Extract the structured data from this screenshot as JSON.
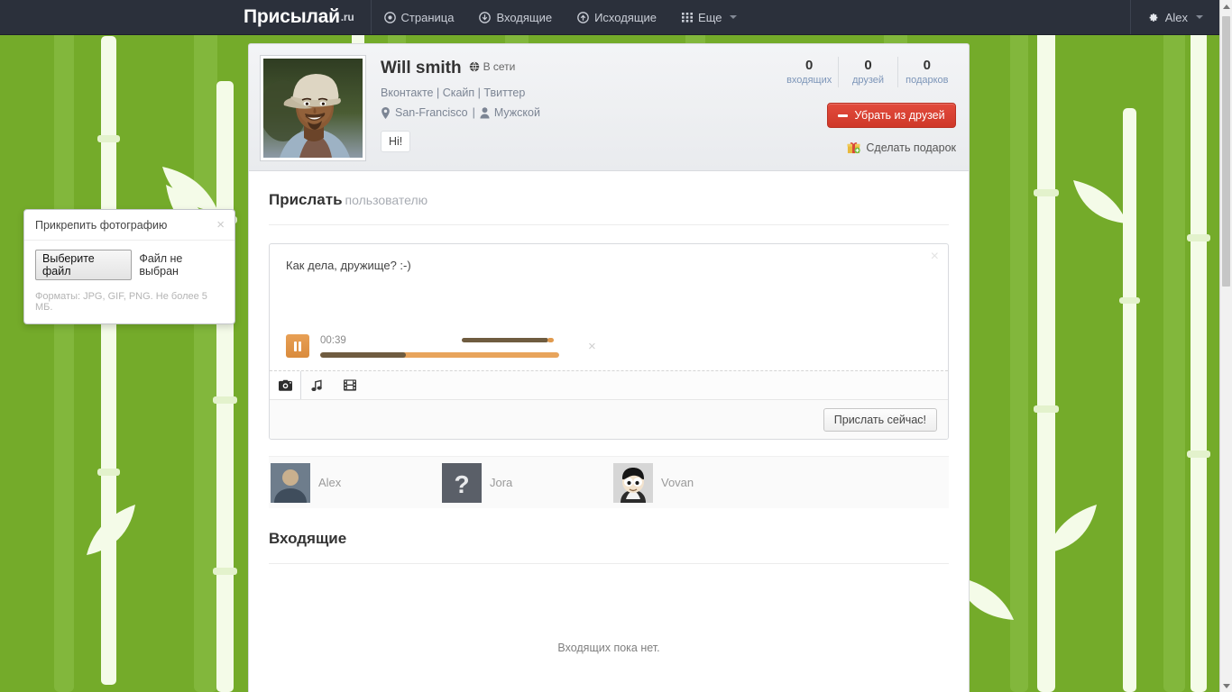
{
  "navbar": {
    "brand": "Присылай",
    "brand_tld": ".ru",
    "items": [
      {
        "label": "Страница",
        "icon": "circle-dot-icon"
      },
      {
        "label": "Входящие",
        "icon": "circle-arrow-down-icon"
      },
      {
        "label": "Исходящие",
        "icon": "circle-arrow-up-icon"
      },
      {
        "label": "Еще",
        "icon": "grid-icon"
      }
    ],
    "user": {
      "label": "Alex",
      "icon": "gear-icon"
    }
  },
  "profile": {
    "name": "Will smith",
    "status": "В сети",
    "links": [
      "Вконтакте",
      "Скайп",
      "Твиттер"
    ],
    "location": "San-Francisco",
    "gender": "Мужской",
    "greeting": "Hi!",
    "stats": [
      {
        "value": "0",
        "label": "входящих"
      },
      {
        "value": "0",
        "label": "друзей"
      },
      {
        "value": "0",
        "label": "подарков"
      }
    ],
    "unfriend_button": "Убрать из друзей",
    "gift_button": "Сделать подарок",
    "accent_red": "#cf3829"
  },
  "send_section": {
    "title": "Прислать",
    "subtitle": "пользователю"
  },
  "composer": {
    "message": "Как дела, дружище? :-)",
    "close": "×",
    "audio": {
      "time": "00:39",
      "progress_percent": 36,
      "volume_percent": 88,
      "remove": "×",
      "state": "playing"
    },
    "attach_tabs": [
      {
        "icon": "camera-icon",
        "active": true
      },
      {
        "icon": "music-note-icon",
        "active": false
      },
      {
        "icon": "film-strip-icon",
        "active": false
      }
    ],
    "send_button": "Прислать сейчас!"
  },
  "file_popover": {
    "title": "Прикрепить фотографию",
    "close": "×",
    "browse_button": "Выберите файл",
    "filename": "Файл не выбран",
    "hint": "Форматы: JPG, GIF, PNG. Не более 5 МБ."
  },
  "friends": [
    {
      "name": "Alex",
      "avatar": "photo"
    },
    {
      "name": "Jora",
      "avatar": "question-placeholder"
    },
    {
      "name": "Vovan",
      "avatar": "cartoon"
    }
  ],
  "inbox": {
    "title": "Входящие",
    "empty_text": "Входящих пока нет."
  }
}
